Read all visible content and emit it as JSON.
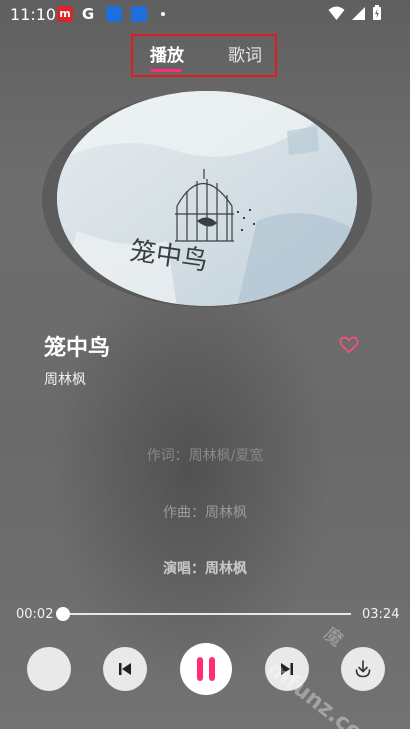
{
  "status_bar": {
    "time": "11:10",
    "g_label": "G"
  },
  "tabs": {
    "play": "播放",
    "lyrics": "歌词"
  },
  "song": {
    "title": "笼中鸟",
    "artist": "周林枫"
  },
  "credits": {
    "lyricist": "作词：周林枫/夏宽",
    "composer": "作曲：周林枫",
    "singer": "演唱：周林枫"
  },
  "progress": {
    "elapsed": "00:02",
    "total": "03:24",
    "fraction": 0.01
  },
  "watermark": {
    "text": "mfunz.com",
    "cn": "魔"
  },
  "album_art": {
    "title_text": "笼中鸟"
  },
  "colors": {
    "accent": "#ff2d78",
    "highlight_border": "#e01b24"
  }
}
